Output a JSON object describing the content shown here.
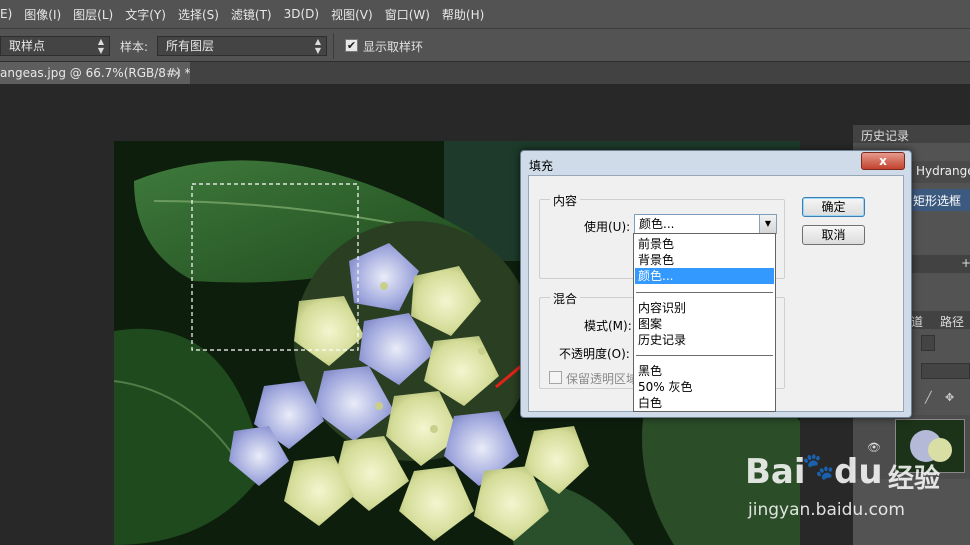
{
  "menubar": {
    "items": [
      "E)",
      "图像(I)",
      "图层(L)",
      "文字(Y)",
      "选择(S)",
      "滤镜(T)",
      "3D(D)",
      "视图(V)",
      "窗口(W)",
      "帮助(H)"
    ]
  },
  "options": {
    "sample_size": "取样点",
    "sample_label": "样本:",
    "sample_value": "所有图层",
    "show_ring_check": "✔",
    "show_ring_label": "显示取样环"
  },
  "tab": {
    "title": "angeas.jpg @ 66.7%(RGB/8#) *",
    "close": "×"
  },
  "right_panel": {
    "history_tab": "历史记录",
    "doc_name": "Hydrangea",
    "history_step": "矩形选框",
    "tab_channels": "道",
    "tab_paths": "路径"
  },
  "dialog": {
    "title": "填充",
    "close": "x",
    "content_group": "内容",
    "use_label": "使用(U):",
    "use_value": "颜色...",
    "blend_group": "混合",
    "mode_label": "模式(M):",
    "opacity_label": "不透明度(O):",
    "preserve_label": "保留透明区域",
    "ok": "确定",
    "cancel": "取消"
  },
  "dropdown": {
    "items": [
      "前景色",
      "背景色",
      "颜色...",
      "内容识别",
      "图案",
      "历史记录",
      "黑色",
      "50% 灰色",
      "白色"
    ],
    "selected_index": 2
  },
  "watermark": {
    "brand": "Bai",
    "brand2": "du",
    "product": "经验",
    "url": "jingyan.baidu.com"
  },
  "colors": {
    "ui_bg": "#535353",
    "selection": "#3399ff",
    "arrow": "#e2231a"
  }
}
